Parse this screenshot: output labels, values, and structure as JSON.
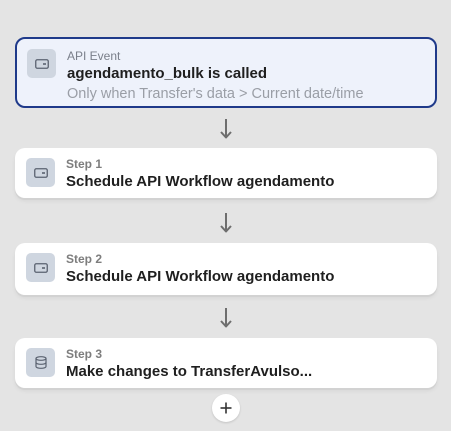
{
  "event": {
    "kicker": "API Event",
    "title": "agendamento_bulk is called",
    "condition": "Only when Transfer's data > Current date/time",
    "icon": "api-icon"
  },
  "steps": [
    {
      "kicker": "Step 1",
      "title": "Schedule API Workflow agendamento",
      "icon": "api-icon"
    },
    {
      "kicker": "Step 2",
      "title": "Schedule API Workflow agendamento",
      "icon": "api-icon"
    },
    {
      "kicker": "Step 3",
      "title": "Make changes to TransferAvulso...",
      "icon": "database-icon"
    }
  ],
  "add_step": {
    "icon": "plus-icon"
  },
  "colors": {
    "background": "#e4e4e4",
    "selected_border": "#1f3a8a",
    "selected_fill": "#eef2fb",
    "icon_tile": "#cfd6e0"
  }
}
